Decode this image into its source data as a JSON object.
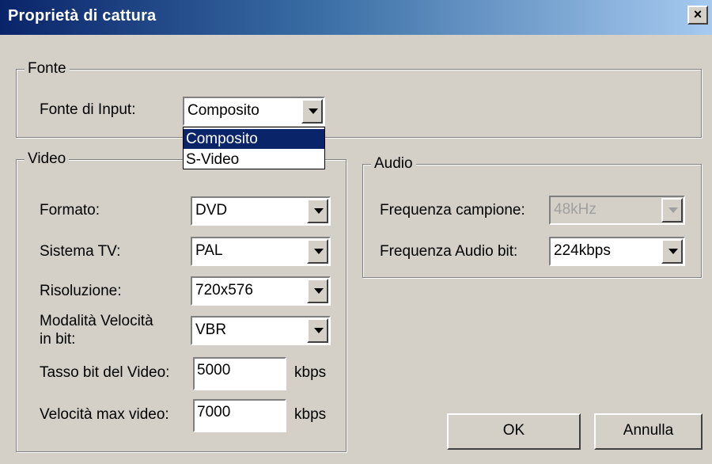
{
  "window": {
    "title": "Proprietà di cattura",
    "close_label": "×"
  },
  "fonte": {
    "legend": "Fonte",
    "input_label": "Fonte di Input:",
    "input_value": "Composito",
    "dropdown_options": [
      "Composito",
      "S-Video"
    ],
    "dropdown_selected_index": 0
  },
  "video": {
    "legend": "Video",
    "formato_label": "Formato:",
    "formato_value": "DVD",
    "sistema_label": "Sistema TV:",
    "sistema_value": "PAL",
    "risoluzione_label": "Risoluzione:",
    "risoluzione_value": "720x576",
    "modalita_label_line1": "Modalità Velocità",
    "modalita_label_line2": "in bit:",
    "modalita_value": "VBR",
    "tasso_label": "Tasso bit del Video:",
    "tasso_value": "5000",
    "tasso_unit": "kbps",
    "max_label": "Velocità max video:",
    "max_value": "7000",
    "max_unit": "kbps"
  },
  "audio": {
    "legend": "Audio",
    "frequenza_label": "Frequenza campione:",
    "frequenza_value": "48kHz",
    "bit_label": "Frequenza Audio bit:",
    "bit_value": "224kbps"
  },
  "buttons": {
    "ok": "OK",
    "cancel": "Annulla"
  },
  "colors": {
    "titlebar_start": "#0a246a",
    "titlebar_end": "#a6caf0",
    "face": "#d4d0c8",
    "highlight": "#0a246a"
  }
}
